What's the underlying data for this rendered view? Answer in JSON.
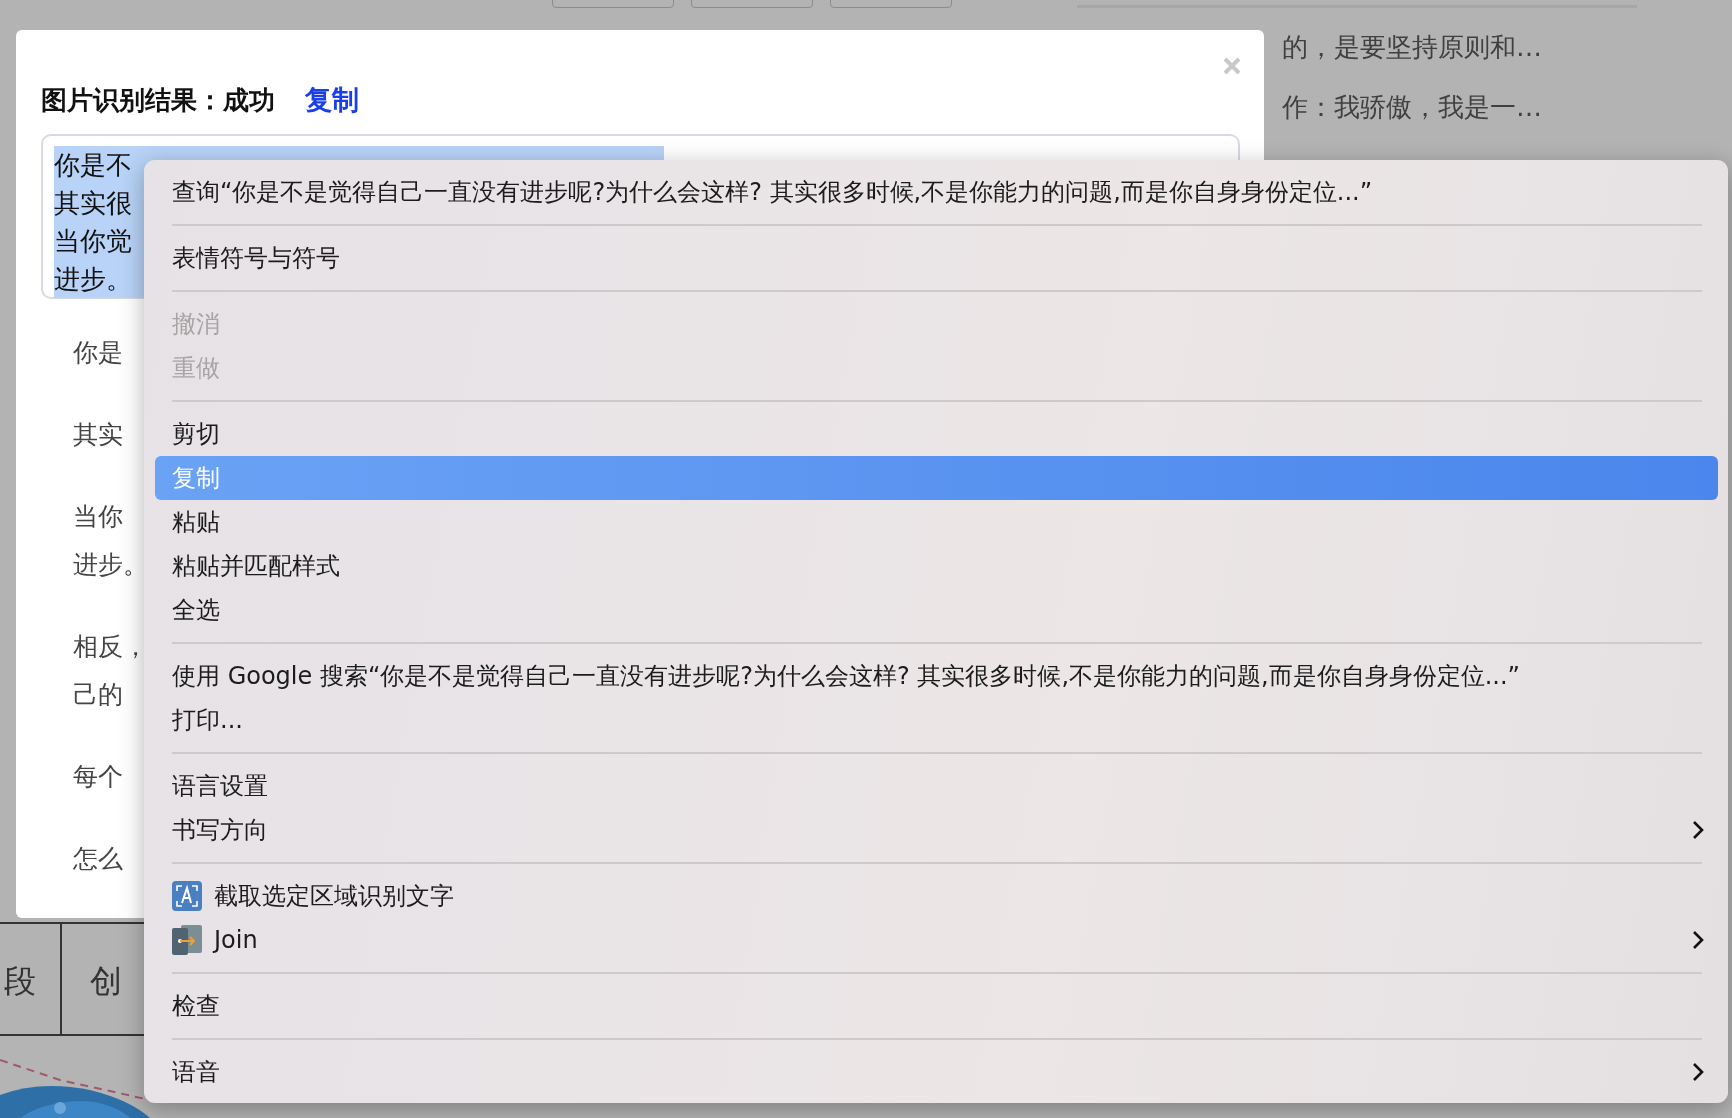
{
  "background": {
    "right_lines": [
      "的，是要坚持原则和…",
      "作：我骄傲，我是一…"
    ],
    "table_cells": [
      "段",
      "创"
    ]
  },
  "dialog": {
    "title": "图片识别结果：成功",
    "copy_link": "复制",
    "result_box": {
      "text_selected": true,
      "lines": [
        "你是不",
        "其实很",
        "当你觉",
        "进步。"
      ]
    },
    "paragraphs": [
      [
        "你是"
      ],
      [
        "其实"
      ],
      [
        "当你",
        "进步。"
      ],
      [
        "相反，",
        "己的"
      ],
      [
        "每个"
      ],
      [
        "怎么"
      ]
    ]
  },
  "context_menu": {
    "items": [
      {
        "kind": "item",
        "label": "查询“你是不是觉得自己一直没有进步呢?为什么会这样? 其实很多时候,不是你能力的问题,而是你自身身份定位...”",
        "disabled": false,
        "selected": false,
        "submenu": false
      },
      {
        "kind": "separator"
      },
      {
        "kind": "item",
        "label": "表情符号与符号",
        "disabled": false,
        "selected": false,
        "submenu": false
      },
      {
        "kind": "separator"
      },
      {
        "kind": "item",
        "label": "撤消",
        "disabled": true,
        "selected": false,
        "submenu": false
      },
      {
        "kind": "item",
        "label": "重做",
        "disabled": true,
        "selected": false,
        "submenu": false
      },
      {
        "kind": "separator"
      },
      {
        "kind": "item",
        "label": "剪切",
        "disabled": false,
        "selected": false,
        "submenu": false
      },
      {
        "kind": "item",
        "label": "复制",
        "disabled": false,
        "selected": true,
        "submenu": false
      },
      {
        "kind": "item",
        "label": "粘贴",
        "disabled": false,
        "selected": false,
        "submenu": false
      },
      {
        "kind": "item",
        "label": "粘贴并匹配样式",
        "disabled": false,
        "selected": false,
        "submenu": false
      },
      {
        "kind": "item",
        "label": "全选",
        "disabled": false,
        "selected": false,
        "submenu": false
      },
      {
        "kind": "separator"
      },
      {
        "kind": "item",
        "label": "使用 Google 搜索“你是不是觉得自己一直没有进步呢?为什么会这样? 其实很多时候,不是你能力的问题,而是你自身身份定位...”",
        "disabled": false,
        "selected": false,
        "submenu": false
      },
      {
        "kind": "item",
        "label": "打印...",
        "disabled": false,
        "selected": false,
        "submenu": false
      },
      {
        "kind": "separator"
      },
      {
        "kind": "item",
        "label": "语言设置",
        "disabled": false,
        "selected": false,
        "submenu": false
      },
      {
        "kind": "item",
        "label": "书写方向",
        "disabled": false,
        "selected": false,
        "submenu": true
      },
      {
        "kind": "separator"
      },
      {
        "kind": "ocr",
        "label": "截取选定区域识别文字",
        "disabled": false,
        "selected": false,
        "submenu": false
      },
      {
        "kind": "join",
        "label": "Join",
        "disabled": false,
        "selected": false,
        "submenu": true
      },
      {
        "kind": "separator"
      },
      {
        "kind": "item",
        "label": "检查",
        "disabled": false,
        "selected": false,
        "submenu": false
      },
      {
        "kind": "separator"
      },
      {
        "kind": "item",
        "label": "语音",
        "disabled": false,
        "selected": false,
        "submenu": true
      }
    ]
  }
}
